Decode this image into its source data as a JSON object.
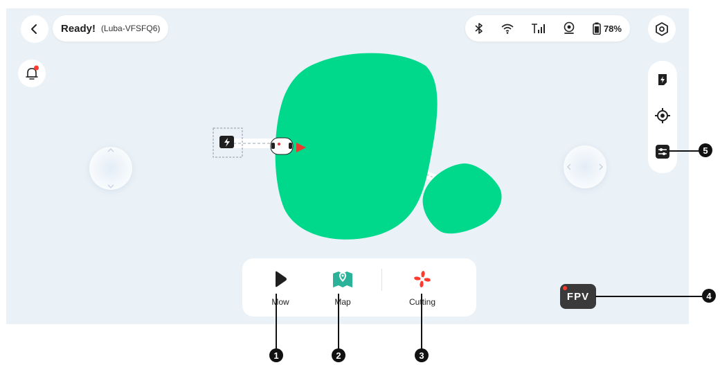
{
  "header": {
    "status_main": "Ready!",
    "status_sub": "(Luba-VFSFQ6)",
    "battery_text": "78%"
  },
  "icons": {
    "back": "chevron-left-icon",
    "bluetooth": "bluetooth-icon",
    "wifi": "wifi-icon",
    "cellular": "cellular-icon",
    "rtk": "rtk-signal-icon",
    "battery": "battery-icon",
    "settings": "hexagon-settings-icon",
    "bell": "bell-icon"
  },
  "right_toolbar": {
    "items": [
      "charge-station-icon",
      "locate-target-icon",
      "adjust-sliders-icon"
    ]
  },
  "bottom_bar": {
    "items": [
      {
        "label": "Mow",
        "icon": "play-icon"
      },
      {
        "label": "Map",
        "icon": "map-pin-icon"
      },
      {
        "label": "Cutting",
        "icon": "fan-blade-icon"
      }
    ]
  },
  "fpv": {
    "label": "FPV"
  },
  "callouts": [
    "1",
    "2",
    "3",
    "4",
    "5"
  ],
  "colors": {
    "lawn": "#00d98b",
    "accent_red": "#ff3b30",
    "map_teal": "#2bb39a",
    "background": "#eaf1f7"
  }
}
